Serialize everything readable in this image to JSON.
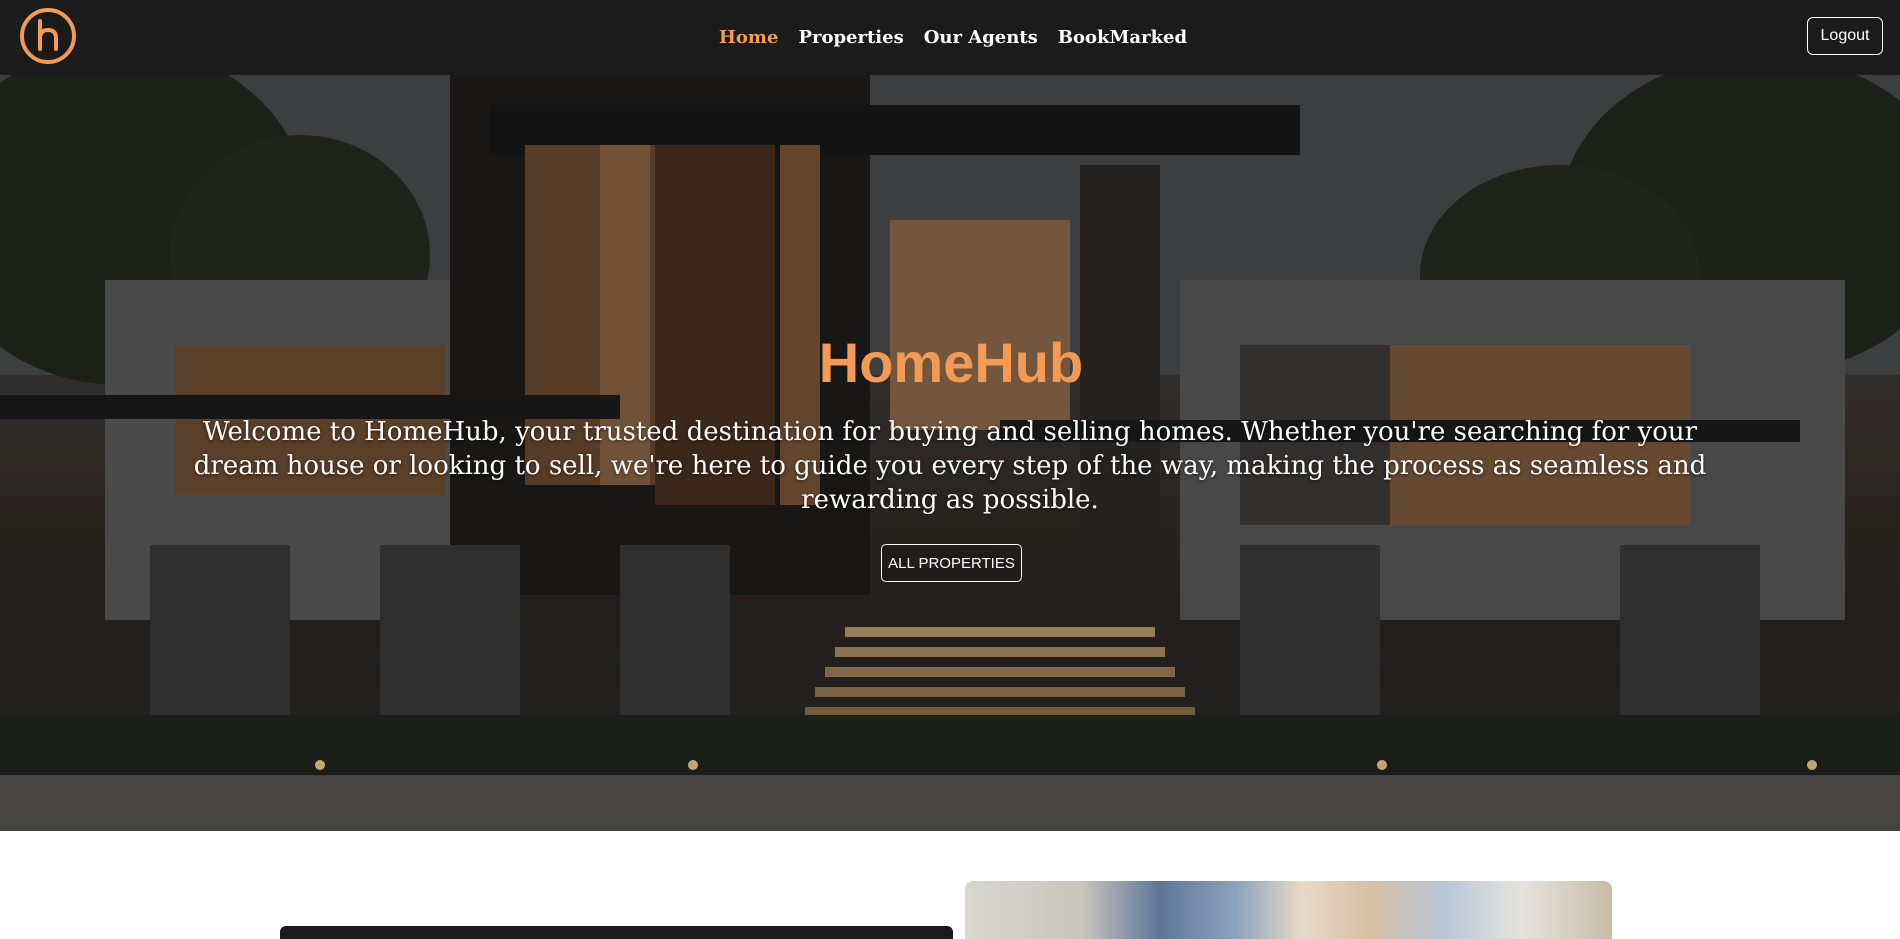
{
  "navbar": {
    "logo_icon": "homehub-logo-icon",
    "links": [
      {
        "label": "Home",
        "active": true
      },
      {
        "label": "Properties",
        "active": false
      },
      {
        "label": "Our Agents",
        "active": false
      },
      {
        "label": "BookMarked",
        "active": false
      }
    ],
    "logout_label": "Logout"
  },
  "hero": {
    "title": "HomeHub",
    "description": "Welcome to HomeHub, your trusted destination for buying and selling homes. Whether you're searching for your dream house or looking to sell, we're here to guide you every step of the way, making the process as seamless and rewarding as possible.",
    "button_label": "ALL PROPERTIES"
  },
  "colors": {
    "accent": "#f39a55",
    "navbar_bg": "#1b1b1b",
    "text_light": "#ffffff"
  }
}
